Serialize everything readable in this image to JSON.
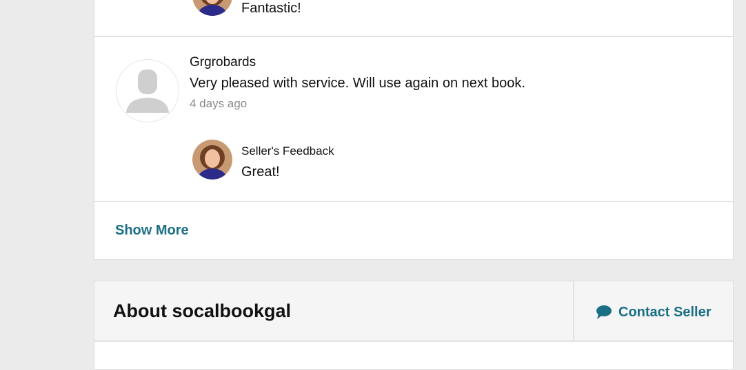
{
  "reviews": {
    "prev_feedback_text": "Fantastic!",
    "review": {
      "name": "Grgrobards",
      "body": "Very pleased with service. Will use again on next book.",
      "time": "4 days ago",
      "seller_feedback_label": "Seller's Feedback",
      "seller_feedback_text": "Great!"
    },
    "show_more_label": "Show More"
  },
  "about": {
    "title": "About socalbookgal",
    "contact_label": "Contact Seller",
    "contact_icon": "chat-bubble-icon"
  },
  "colors": {
    "link": "#1a6e85",
    "page_bg": "#ebebeb",
    "header_bg": "#f5f5f5"
  }
}
